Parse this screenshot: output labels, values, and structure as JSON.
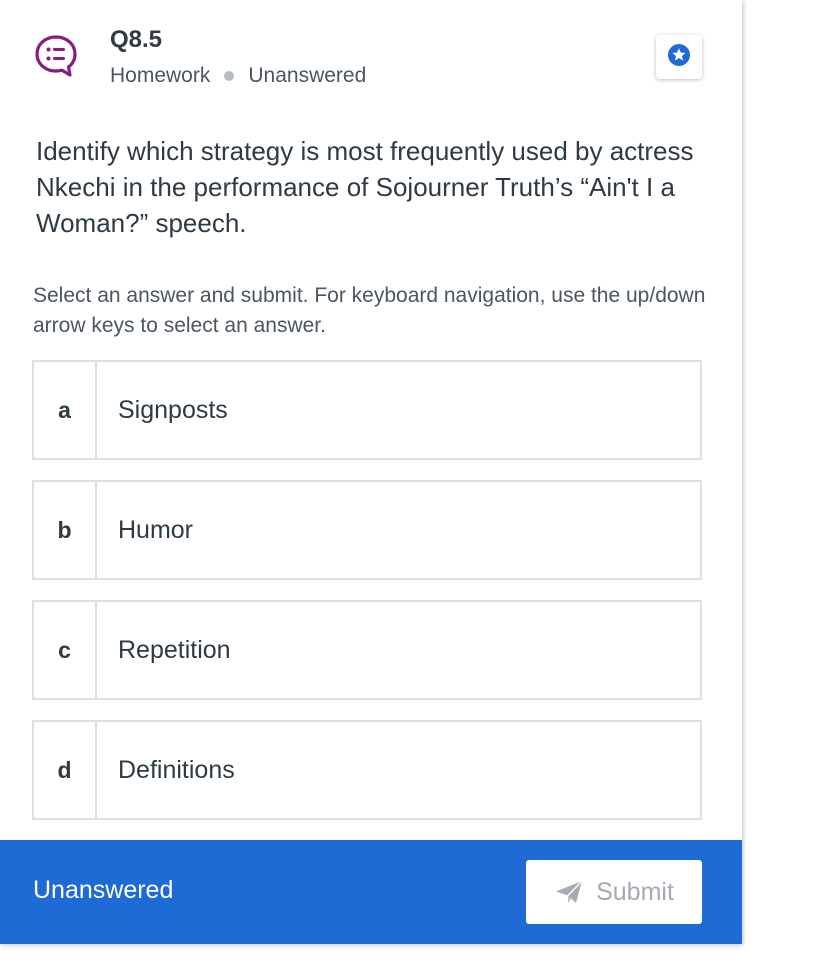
{
  "question": {
    "number": "Q8.5",
    "category": "Homework",
    "status": "Unanswered",
    "prompt": "Identify which strategy is most frequently used by actress Nkechi in the performance of Sojourner Truth’s “Ain't I a Woman?” speech.",
    "instructions": "Select an answer and submit. For keyboard navigation, use the up/down arrow keys to select an answer."
  },
  "icons": {
    "question_icon": "speech-bubble-list-icon",
    "bookmark_icon": "star-bookmark-icon",
    "submit_icon": "paper-plane-icon"
  },
  "choices": [
    {
      "letter": "a",
      "text": "Signposts"
    },
    {
      "letter": "b",
      "text": "Humor"
    },
    {
      "letter": "c",
      "text": "Repetition"
    },
    {
      "letter": "d",
      "text": "Definitions"
    }
  ],
  "footer": {
    "status": "Unanswered",
    "submit_label": "Submit"
  },
  "colors": {
    "accent": "#1e6bd6",
    "icon_purple": "#8a1c7c",
    "text": "#2d3b45",
    "border": "#dcdfe3"
  }
}
